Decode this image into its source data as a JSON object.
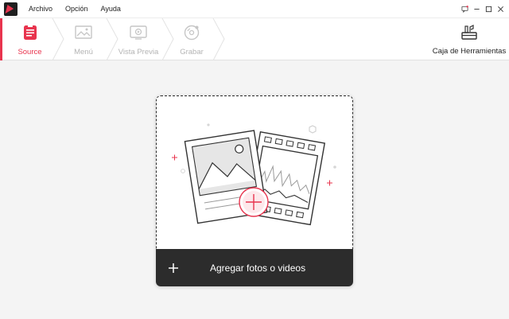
{
  "menubar": {
    "items": [
      "Archivo",
      "Opción",
      "Ayuda"
    ]
  },
  "steps": {
    "source": "Source",
    "menu": "Menú",
    "preview": "Vista Previa",
    "burn": "Grabar"
  },
  "toolbox": {
    "label": "Caja de Herramientas"
  },
  "dropzone": {
    "add_label": "Agregar fotos o videos"
  },
  "colors": {
    "accent": "#e8344e",
    "dark_bar": "#2c2c2c",
    "inactive": "#b4b4b4",
    "background": "#f4f4f4"
  }
}
